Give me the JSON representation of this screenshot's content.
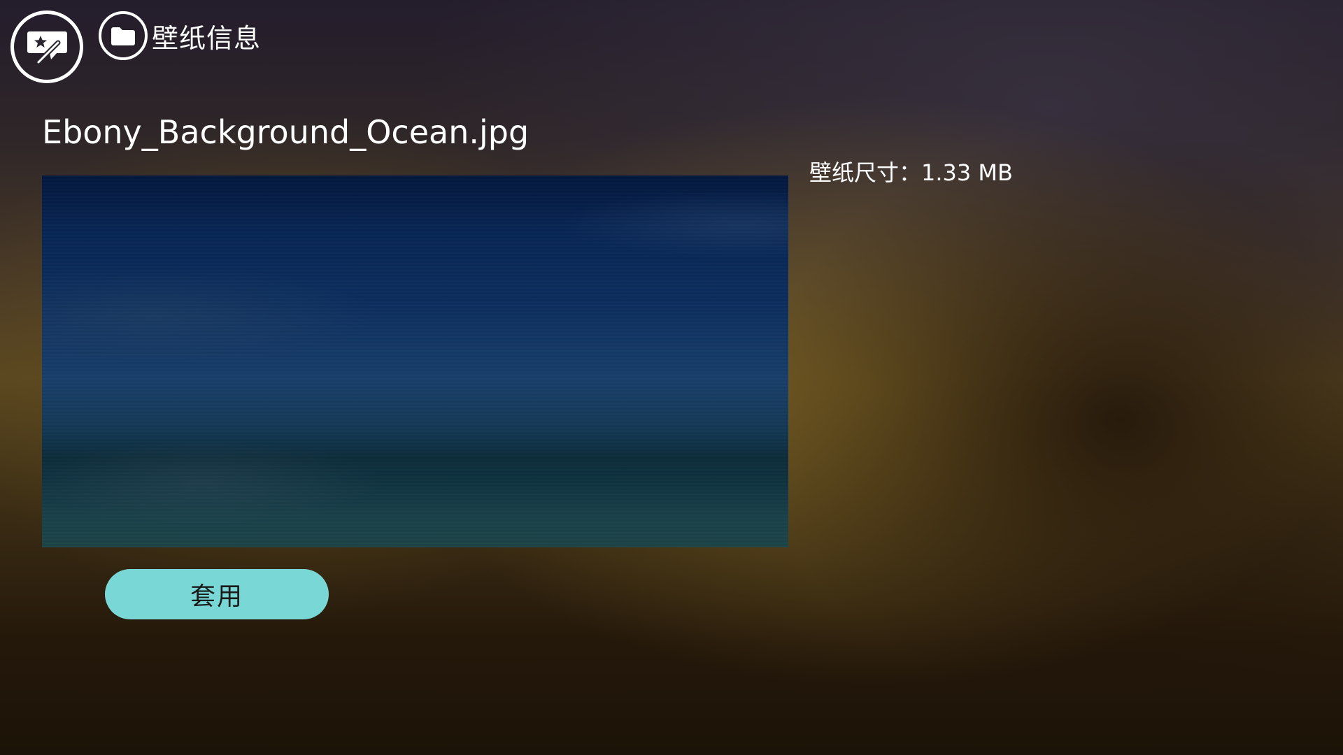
{
  "header": {
    "app_icon": "wallpaper-edit-icon",
    "breadcrumb_icon": "folder-icon",
    "title": "壁纸信息"
  },
  "wallpaper": {
    "file_name": "Ebony_Background_Ocean.jpg",
    "size_label": "壁纸尺寸：1.33 MB"
  },
  "actions": {
    "apply_label": "套用"
  },
  "colors": {
    "button_accent": "#79d8d6"
  }
}
